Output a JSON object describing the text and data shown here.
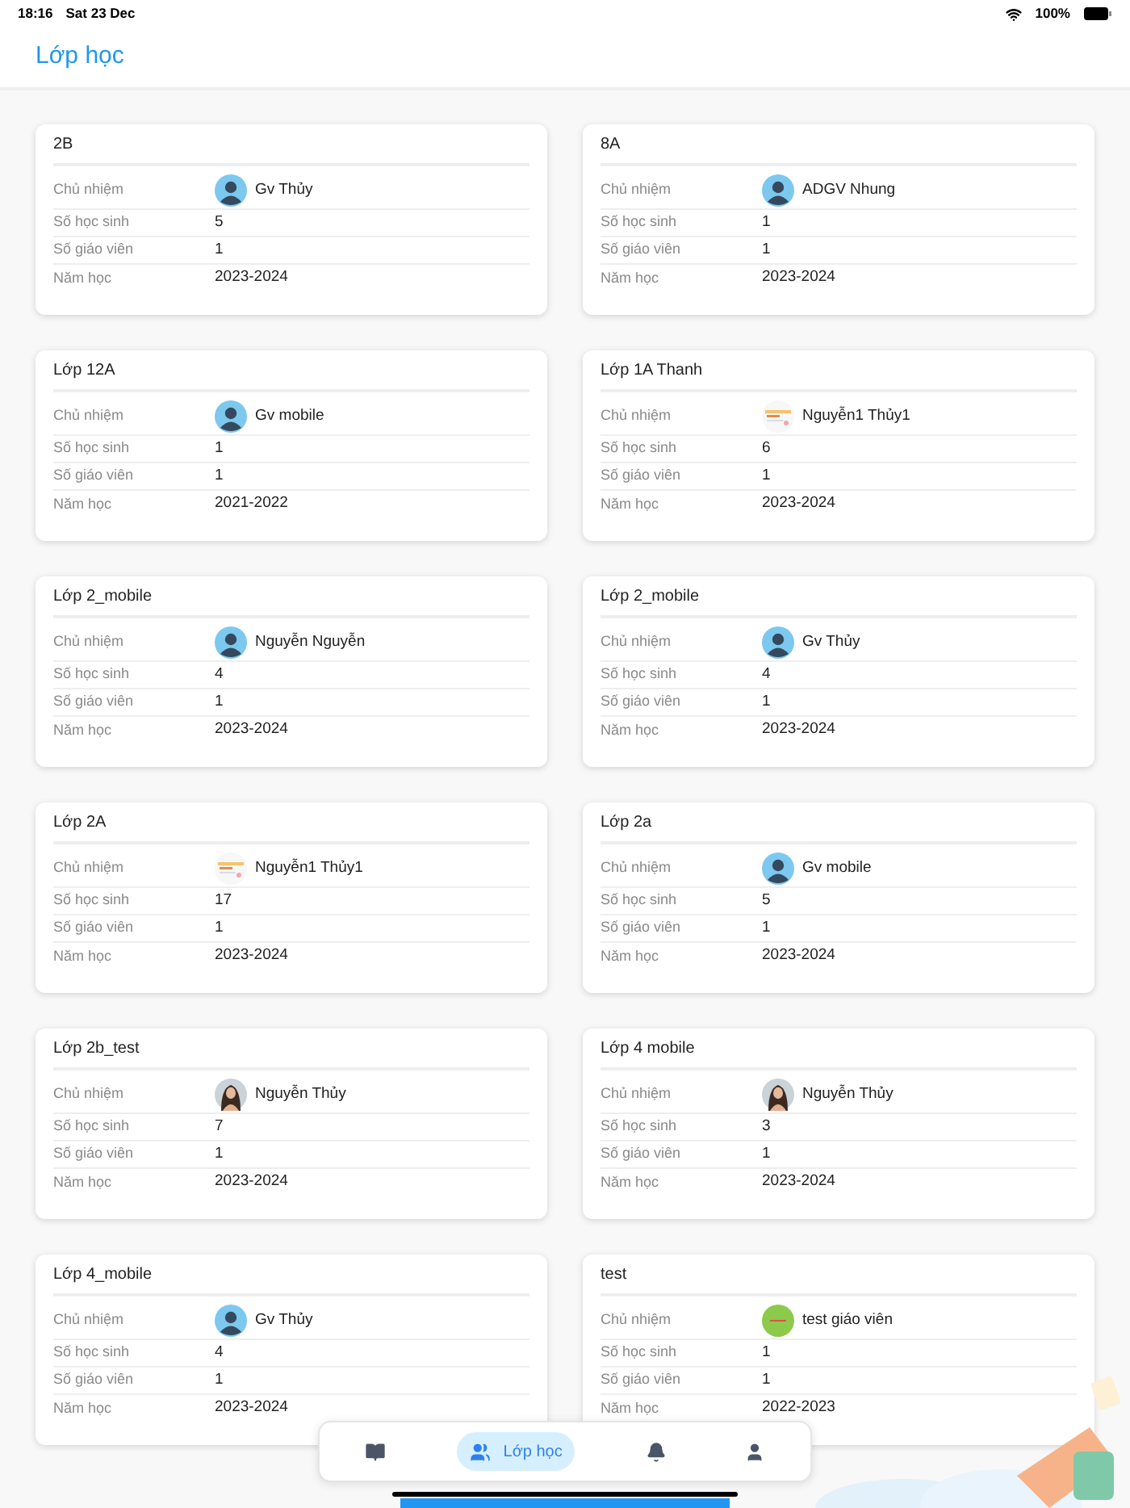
{
  "status_bar": {
    "time": "18:16",
    "date": "Sat 23 Dec",
    "battery": "100%"
  },
  "header": {
    "title": "Lớp học"
  },
  "classes": [
    {
      "name": "2B",
      "teacher_label": "Chủ nhiệm",
      "teacher": "Gv Thủy",
      "kind": "silhouette",
      "rows": [
        {
          "label": "Số học sinh",
          "value": "5"
        },
        {
          "label": "Số giáo viên",
          "value": "1"
        },
        {
          "label": "Năm học",
          "value": "2023-2024"
        }
      ]
    },
    {
      "name": "8A",
      "teacher_label": "Chủ nhiệm",
      "teacher": "ADGV Nhung",
      "kind": "silhouette",
      "rows": [
        {
          "label": "Số học sinh",
          "value": "1"
        },
        {
          "label": "Số giáo viên",
          "value": "1"
        },
        {
          "label": "Năm học",
          "value": "2023-2024"
        }
      ]
    },
    {
      "name": "Lớp 12A",
      "teacher_label": "Chủ nhiệm",
      "teacher": "Gv mobile",
      "kind": "silhouette",
      "rows": [
        {
          "label": "Số học sinh",
          "value": "1"
        },
        {
          "label": "Số giáo viên",
          "value": "1"
        },
        {
          "label": "Năm học",
          "value": "2021-2022"
        }
      ]
    },
    {
      "name": "Lớp 1A Thanh",
      "teacher_label": "Chủ nhiệm",
      "teacher": "Nguyễn1 Thủy1",
      "kind": "picture",
      "rows": [
        {
          "label": "Số học sinh",
          "value": "6"
        },
        {
          "label": "Số giáo viên",
          "value": "1"
        },
        {
          "label": "Năm học",
          "value": "2023-2024"
        }
      ]
    },
    {
      "name": "Lớp 2_mobile",
      "teacher_label": "Chủ nhiệm",
      "teacher": "Nguyễn Nguyễn",
      "kind": "silhouette",
      "rows": [
        {
          "label": "Số học sinh",
          "value": "4"
        },
        {
          "label": "Số giáo viên",
          "value": "1"
        },
        {
          "label": "Năm học",
          "value": "2023-2024"
        }
      ]
    },
    {
      "name": "Lớp 2_mobile",
      "teacher_label": "Chủ nhiệm",
      "teacher": "Gv Thủy",
      "kind": "silhouette",
      "rows": [
        {
          "label": "Số học sinh",
          "value": "4"
        },
        {
          "label": "Số giáo viên",
          "value": "1"
        },
        {
          "label": "Năm học",
          "value": "2023-2024"
        }
      ]
    },
    {
      "name": "Lớp 2A",
      "teacher_label": "Chủ nhiệm",
      "teacher": "Nguyễn1 Thủy1",
      "kind": "picture",
      "rows": [
        {
          "label": "Số học sinh",
          "value": "17"
        },
        {
          "label": "Số giáo viên",
          "value": "1"
        },
        {
          "label": "Năm học",
          "value": "2023-2024"
        }
      ]
    },
    {
      "name": "Lớp 2a",
      "teacher_label": "Chủ nhiệm",
      "teacher": "Gv mobile",
      "kind": "silhouette",
      "rows": [
        {
          "label": "Số học sinh",
          "value": "5"
        },
        {
          "label": "Số giáo viên",
          "value": "1"
        },
        {
          "label": "Năm học",
          "value": "2023-2024"
        }
      ]
    },
    {
      "name": "Lớp 2b_test",
      "teacher_label": "Chủ nhiệm",
      "teacher": "Nguyễn Thủy",
      "rows": [
        {
          "label": "Số học sinh",
          "value": "7"
        },
        {
          "label": "Số giáo viên",
          "value": "1"
        },
        {
          "label": "Năm học",
          "value": "2023-2024"
        }
      ]
    },
    {
      "name": "Lớp 4 mobile",
      "teacher_label": "Chủ nhiệm",
      "teacher": "Nguyễn Thủy",
      "rows": [
        {
          "label": "Số học sinh",
          "value": "3"
        },
        {
          "label": "Số giáo viên",
          "value": "1"
        },
        {
          "label": "Năm học",
          "value": "2023-2024"
        }
      ]
    },
    {
      "name": "Lớp 4_mobile",
      "teacher_label": "Chủ nhiệm",
      "teacher": "Gv Thủy",
      "kind": "silhouette",
      "rows": [
        {
          "label": "Số học sinh",
          "value": "4"
        },
        {
          "label": "Số giáo viên",
          "value": "1"
        },
        {
          "label": "Năm học",
          "value": "2023-2024"
        }
      ]
    },
    {
      "name": "test",
      "teacher_label": "Chủ nhiệm",
      "teacher": "test giáo viên",
      "kind": "badge",
      "rows": [
        {
          "label": "Số học sinh",
          "value": "1"
        },
        {
          "label": "Số giáo viên",
          "value": "1"
        },
        {
          "label": "Năm học",
          "value": "2022-2023"
        }
      ]
    }
  ],
  "tab_bar": [
    {
      "selected": false
    },
    {
      "label": "Lớp học",
      "selected": true
    },
    {
      "selected": false
    },
    {
      "selected": false
    }
  ]
}
